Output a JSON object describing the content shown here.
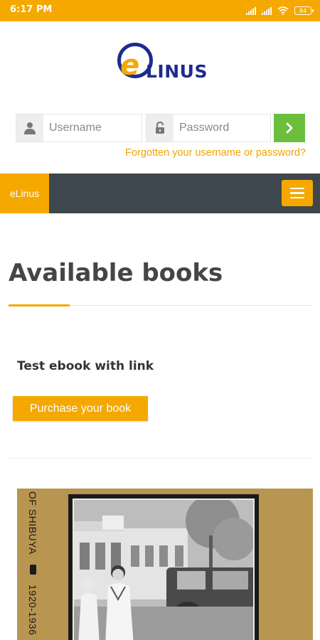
{
  "status_bar": {
    "time": "6:17 PM",
    "battery": "84"
  },
  "logo": {
    "text": "LINUS"
  },
  "login": {
    "username_placeholder": "Username",
    "password_placeholder": "Password",
    "forgot_link": "Forgotten your username or password?"
  },
  "nav": {
    "brand": "eLinus"
  },
  "main": {
    "title": "Available books",
    "books": [
      {
        "title": "Test ebook with link",
        "button": "Purchase your book",
        "cover_spine": {
          "title": "OF SHIBUYA",
          "years": "1920-1936"
        }
      }
    ]
  },
  "colors": {
    "accent": "#f5a800",
    "nav_bg": "#3e474d",
    "go_button": "#6cbf3c",
    "logo_blue": "#1d2b8f",
    "cover": "#b89550"
  }
}
